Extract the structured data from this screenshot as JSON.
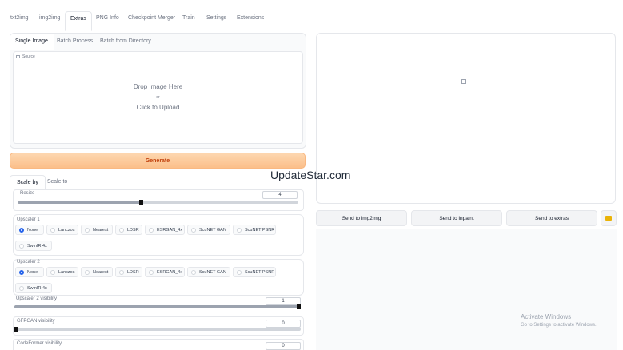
{
  "top_tabs": [
    "txt2img",
    "img2img",
    "Extras",
    "PNG Info",
    "Checkpoint Merger",
    "Train",
    "Settings",
    "Extensions"
  ],
  "sub_tabs": [
    "Single Image",
    "Batch Process",
    "Batch from Directory"
  ],
  "source_label": "Source",
  "drop": {
    "line1": "Drop Image Here",
    "line2": "- or -",
    "line3": "Click to Upload"
  },
  "generate_label": "Generate",
  "scale_tabs": [
    "Scale by",
    "Scale to"
  ],
  "resize": {
    "label": "Resize",
    "value": "4",
    "level_fraction": 0.44
  },
  "upscaler1": {
    "label": "Upscaler 1",
    "options": [
      "None",
      "Lanczos",
      "Nearest",
      "LDSR",
      "ESRGAN_4x",
      "ScuNET GAN",
      "ScuNET PSNR",
      "SwinIR 4x"
    ],
    "selected": "None"
  },
  "upscaler2": {
    "label": "Upscaler 2",
    "options": [
      "None",
      "Lanczos",
      "Nearest",
      "LDSR",
      "ESRGAN_4x",
      "ScuNET GAN",
      "ScuNET PSNR",
      "SwinIR 4x"
    ],
    "selected": "None"
  },
  "upscaler2_visibility": {
    "label": "Upscaler 2 visibility",
    "value": "1",
    "level_fraction": 1.0
  },
  "gfpgan_visibility": {
    "label": "GFPGAN visibility",
    "value": "0",
    "level_fraction": 0.0
  },
  "codeformer_visibility": {
    "label": "CodeFormer visibility",
    "value": "0"
  },
  "send_buttons": [
    "Send to img2img",
    "Send to inpaint",
    "Send to extras"
  ],
  "watermark": "UpdateStar.com",
  "activate": {
    "line1": "Activate Windows",
    "line2": "Go to Settings to activate Windows."
  },
  "colors": {
    "accent": "#2563eb",
    "generate_bg": "#fbbf8a",
    "folder": "#eab308"
  }
}
